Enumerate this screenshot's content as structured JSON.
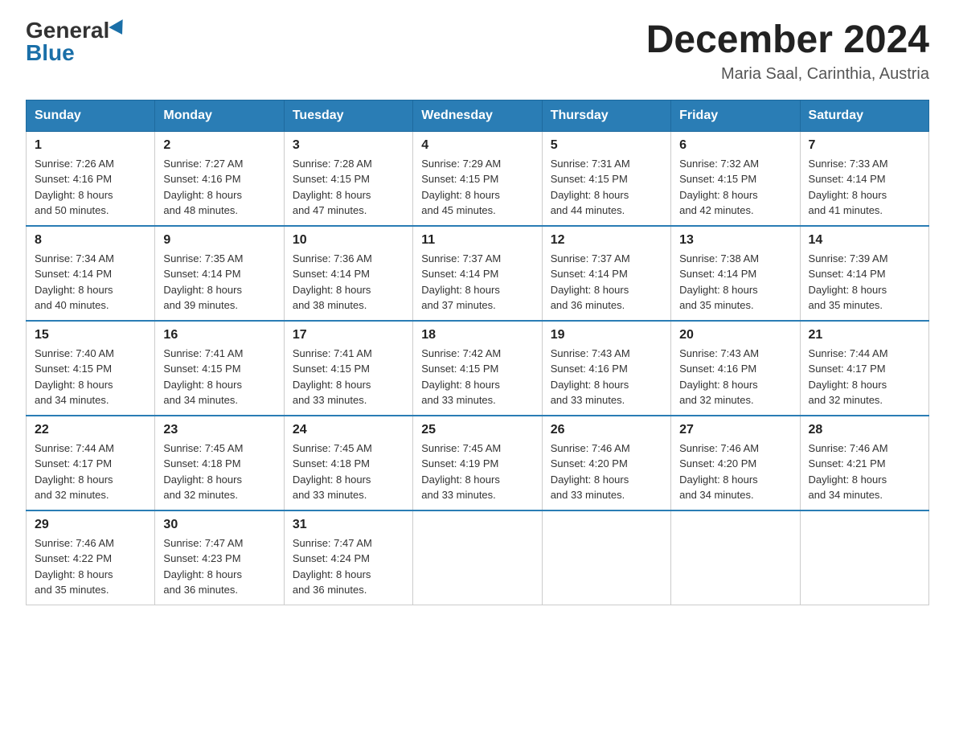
{
  "header": {
    "logo_general": "General",
    "logo_blue": "Blue",
    "month_year": "December 2024",
    "location": "Maria Saal, Carinthia, Austria"
  },
  "days_of_week": [
    "Sunday",
    "Monday",
    "Tuesday",
    "Wednesday",
    "Thursday",
    "Friday",
    "Saturday"
  ],
  "weeks": [
    [
      {
        "day": "1",
        "sunrise": "7:26 AM",
        "sunset": "4:16 PM",
        "daylight": "8 hours and 50 minutes."
      },
      {
        "day": "2",
        "sunrise": "7:27 AM",
        "sunset": "4:16 PM",
        "daylight": "8 hours and 48 minutes."
      },
      {
        "day": "3",
        "sunrise": "7:28 AM",
        "sunset": "4:15 PM",
        "daylight": "8 hours and 47 minutes."
      },
      {
        "day": "4",
        "sunrise": "7:29 AM",
        "sunset": "4:15 PM",
        "daylight": "8 hours and 45 minutes."
      },
      {
        "day": "5",
        "sunrise": "7:31 AM",
        "sunset": "4:15 PM",
        "daylight": "8 hours and 44 minutes."
      },
      {
        "day": "6",
        "sunrise": "7:32 AM",
        "sunset": "4:15 PM",
        "daylight": "8 hours and 42 minutes."
      },
      {
        "day": "7",
        "sunrise": "7:33 AM",
        "sunset": "4:14 PM",
        "daylight": "8 hours and 41 minutes."
      }
    ],
    [
      {
        "day": "8",
        "sunrise": "7:34 AM",
        "sunset": "4:14 PM",
        "daylight": "8 hours and 40 minutes."
      },
      {
        "day": "9",
        "sunrise": "7:35 AM",
        "sunset": "4:14 PM",
        "daylight": "8 hours and 39 minutes."
      },
      {
        "day": "10",
        "sunrise": "7:36 AM",
        "sunset": "4:14 PM",
        "daylight": "8 hours and 38 minutes."
      },
      {
        "day": "11",
        "sunrise": "7:37 AM",
        "sunset": "4:14 PM",
        "daylight": "8 hours and 37 minutes."
      },
      {
        "day": "12",
        "sunrise": "7:37 AM",
        "sunset": "4:14 PM",
        "daylight": "8 hours and 36 minutes."
      },
      {
        "day": "13",
        "sunrise": "7:38 AM",
        "sunset": "4:14 PM",
        "daylight": "8 hours and 35 minutes."
      },
      {
        "day": "14",
        "sunrise": "7:39 AM",
        "sunset": "4:14 PM",
        "daylight": "8 hours and 35 minutes."
      }
    ],
    [
      {
        "day": "15",
        "sunrise": "7:40 AM",
        "sunset": "4:15 PM",
        "daylight": "8 hours and 34 minutes."
      },
      {
        "day": "16",
        "sunrise": "7:41 AM",
        "sunset": "4:15 PM",
        "daylight": "8 hours and 34 minutes."
      },
      {
        "day": "17",
        "sunrise": "7:41 AM",
        "sunset": "4:15 PM",
        "daylight": "8 hours and 33 minutes."
      },
      {
        "day": "18",
        "sunrise": "7:42 AM",
        "sunset": "4:15 PM",
        "daylight": "8 hours and 33 minutes."
      },
      {
        "day": "19",
        "sunrise": "7:43 AM",
        "sunset": "4:16 PM",
        "daylight": "8 hours and 33 minutes."
      },
      {
        "day": "20",
        "sunrise": "7:43 AM",
        "sunset": "4:16 PM",
        "daylight": "8 hours and 32 minutes."
      },
      {
        "day": "21",
        "sunrise": "7:44 AM",
        "sunset": "4:17 PM",
        "daylight": "8 hours and 32 minutes."
      }
    ],
    [
      {
        "day": "22",
        "sunrise": "7:44 AM",
        "sunset": "4:17 PM",
        "daylight": "8 hours and 32 minutes."
      },
      {
        "day": "23",
        "sunrise": "7:45 AM",
        "sunset": "4:18 PM",
        "daylight": "8 hours and 32 minutes."
      },
      {
        "day": "24",
        "sunrise": "7:45 AM",
        "sunset": "4:18 PM",
        "daylight": "8 hours and 33 minutes."
      },
      {
        "day": "25",
        "sunrise": "7:45 AM",
        "sunset": "4:19 PM",
        "daylight": "8 hours and 33 minutes."
      },
      {
        "day": "26",
        "sunrise": "7:46 AM",
        "sunset": "4:20 PM",
        "daylight": "8 hours and 33 minutes."
      },
      {
        "day": "27",
        "sunrise": "7:46 AM",
        "sunset": "4:20 PM",
        "daylight": "8 hours and 34 minutes."
      },
      {
        "day": "28",
        "sunrise": "7:46 AM",
        "sunset": "4:21 PM",
        "daylight": "8 hours and 34 minutes."
      }
    ],
    [
      {
        "day": "29",
        "sunrise": "7:46 AM",
        "sunset": "4:22 PM",
        "daylight": "8 hours and 35 minutes."
      },
      {
        "day": "30",
        "sunrise": "7:47 AM",
        "sunset": "4:23 PM",
        "daylight": "8 hours and 36 minutes."
      },
      {
        "day": "31",
        "sunrise": "7:47 AM",
        "sunset": "4:24 PM",
        "daylight": "8 hours and 36 minutes."
      },
      null,
      null,
      null,
      null
    ]
  ],
  "labels": {
    "sunrise": "Sunrise:",
    "sunset": "Sunset:",
    "daylight": "Daylight:"
  },
  "colors": {
    "header_bg": "#2a7db5",
    "header_text": "#ffffff",
    "border": "#2a7db5"
  }
}
